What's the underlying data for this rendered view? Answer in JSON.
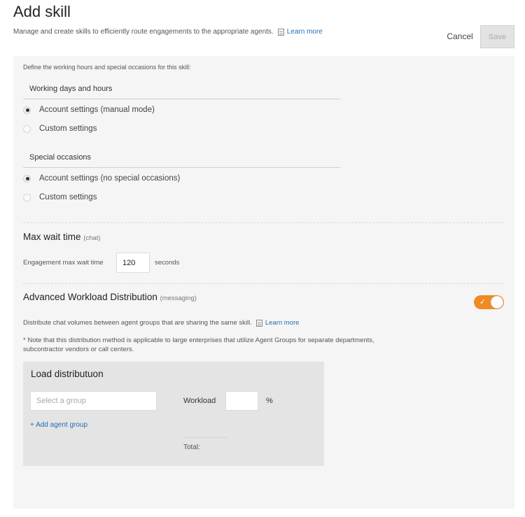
{
  "header": {
    "title": "Add skill",
    "subtitle": "Manage and create skills to efficiently route engagements to the appropriate agents.",
    "learn_more": "Learn more",
    "cancel_label": "Cancel",
    "save_label": "Save"
  },
  "hours": {
    "intro": "Define the working hours and special occasions for this skill:",
    "working_days": {
      "title": "Working days and hours",
      "options": [
        {
          "label": "Account settings (manual mode)",
          "selected": true
        },
        {
          "label": "Custom settings",
          "selected": false
        }
      ]
    },
    "special": {
      "title": "Special occasions",
      "options": [
        {
          "label": "Account settings (no special occasions)",
          "selected": true
        },
        {
          "label": "Custom settings",
          "selected": false
        }
      ]
    }
  },
  "max_wait": {
    "title": "Max wait time",
    "qualifier": "(chat)",
    "label": "Engagement max wait time",
    "value": "120",
    "unit": "seconds"
  },
  "awd": {
    "title": "Advanced Workload Distribution",
    "qualifier": "(messaging)",
    "enabled": true,
    "toggle_check": "✓",
    "description": "Distribute chat volumes between agent groups that are sharing the same skill.",
    "learn_more": "Learn more",
    "note": "* Note that this distribution method is applicable to large enterprises that utilize Agent Groups for separate departments, subcontractor vendors or call centers.",
    "load": {
      "title": "Load distributuon",
      "group_placeholder": "Select a group",
      "workload_label": "Workload",
      "workload_value": "",
      "percent": "%",
      "add_group": "+ Add agent group",
      "total_label": "Total:"
    }
  },
  "colors": {
    "accent": "#f08a24",
    "link": "#1f6fb5",
    "panel_bg": "#f5f5f5"
  }
}
